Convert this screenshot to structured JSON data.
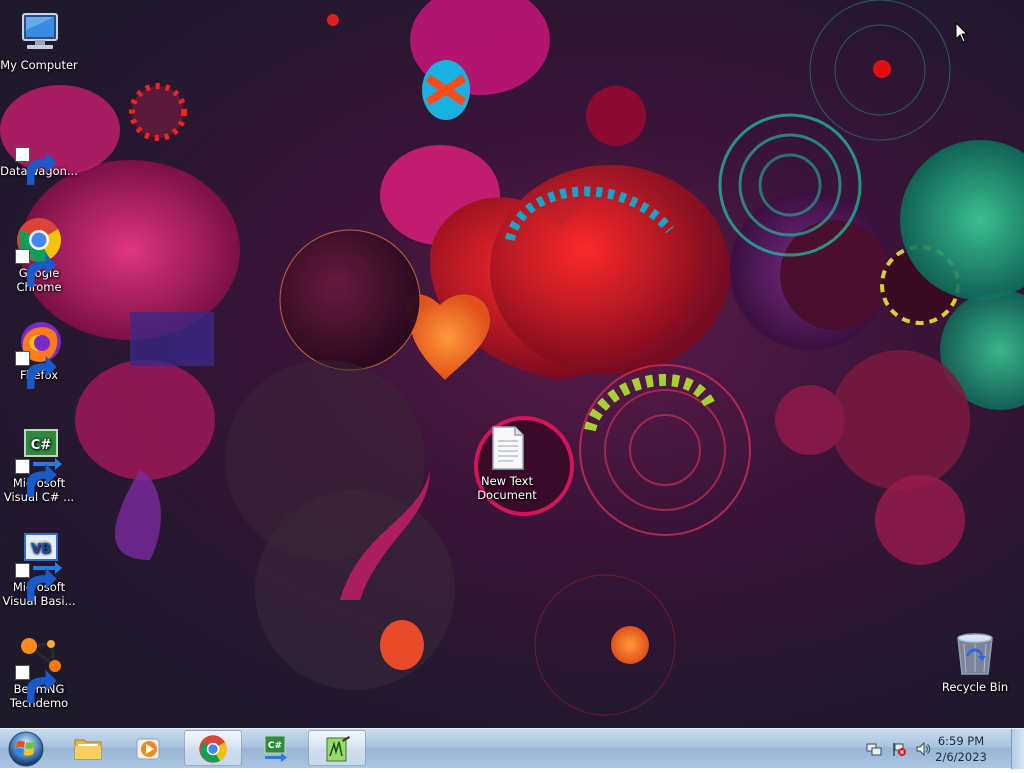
{
  "desktop": {
    "icons": [
      {
        "label": "My Computer",
        "icon": "computer-icon",
        "shortcut": false
      },
      {
        "label": "DataWagon...",
        "icon": "datawagon-icon",
        "shortcut": true
      },
      {
        "label": "Google Chrome",
        "icon": "chrome-icon",
        "shortcut": true
      },
      {
        "label": "Firefox",
        "icon": "firefox-icon",
        "shortcut": true
      },
      {
        "label": "Microsoft Visual C# ...",
        "icon": "visual-csharp-icon",
        "shortcut": true
      },
      {
        "label": "Microsoft Visual Basi...",
        "icon": "visual-basic-icon",
        "shortcut": true
      },
      {
        "label": "BeamNG Techdemo",
        "icon": "beamng-icon",
        "shortcut": true
      },
      {
        "label": "New Text Document",
        "icon": "text-document-icon",
        "shortcut": false
      },
      {
        "label": "Recycle Bin",
        "icon": "recycle-bin-icon",
        "shortcut": false
      }
    ]
  },
  "taskbar": {
    "start": {
      "icon": "windows-logo-icon"
    },
    "pinned": [
      {
        "name": "windows-explorer",
        "icon": "folder-icon",
        "active": false
      },
      {
        "name": "media-player",
        "icon": "media-player-icon",
        "active": false
      },
      {
        "name": "google-chrome",
        "icon": "chrome-icon",
        "active": true
      },
      {
        "name": "visual-csharp",
        "icon": "visual-csharp-icon",
        "active": false
      },
      {
        "name": "notepad-plus-plus",
        "icon": "notepad-icon",
        "active": true
      }
    ],
    "tray": {
      "icons": [
        "network-icon",
        "action-center-flag-icon",
        "speaker-icon"
      ],
      "time": "6:59 PM",
      "date": "2/6/2023"
    }
  },
  "colors": {
    "taskbar_top": "#c9dcef",
    "taskbar_bottom": "#98b5d4",
    "wallpaper_base": "#23182e",
    "wallpaper_accent": "#d4145a"
  }
}
